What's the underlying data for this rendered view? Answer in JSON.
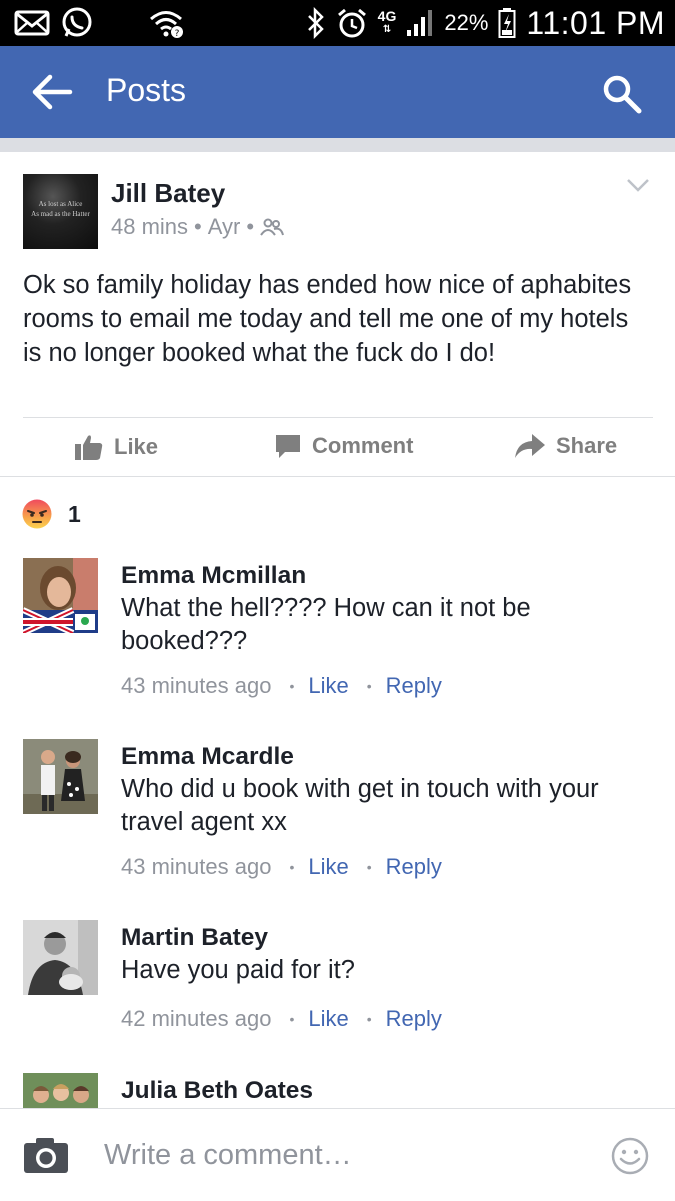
{
  "status_bar": {
    "network": "4G",
    "battery": "22%",
    "time": "11:01 PM",
    "icons": [
      "mail-icon",
      "whatsapp-icon",
      "wifi-icon",
      "bluetooth-icon",
      "alarm-icon",
      "signal-icon",
      "battery-icon"
    ]
  },
  "app_bar": {
    "title": "Posts",
    "icons": [
      "back-arrow-icon",
      "search-icon"
    ]
  },
  "post": {
    "author": "Jill Batey",
    "time": "48 mins",
    "location": "Ayr",
    "privacy_icon": "friends-icon",
    "avatar_text": [
      "As lost as Alice",
      "As mad as the Hatter"
    ],
    "text": "Ok so family holiday has ended how nice of aphabites rooms to email me today and tell me one of my hotels is no longer booked what the fuck do I do!",
    "actions": {
      "like": "Like",
      "comment": "Comment",
      "share": "Share"
    }
  },
  "reactions": {
    "icon": "angry-reaction-icon",
    "count": "1"
  },
  "comments": [
    {
      "name": "Emma Mcmillan",
      "text": "What the hell???? How can it not be booked???",
      "time": "43 minutes ago",
      "like": "Like",
      "reply": "Reply"
    },
    {
      "name": "Emma Mcardle",
      "text": "Who did u book with get in touch with your travel agent  xx",
      "time": "43 minutes ago",
      "like": "Like",
      "reply": "Reply"
    },
    {
      "name": "Martin Batey",
      "text": "Have you paid for it?",
      "time": "42 minutes ago",
      "like": "Like",
      "reply": "Reply"
    },
    {
      "name": "Julia Beth Oates"
    }
  ],
  "composer": {
    "placeholder": "Write a comment…",
    "icons": [
      "camera-icon",
      "emoji-icon"
    ]
  },
  "colors": {
    "brand_blue": "#4267b2",
    "meta_gray": "#90949c",
    "text": "#1d2129"
  }
}
